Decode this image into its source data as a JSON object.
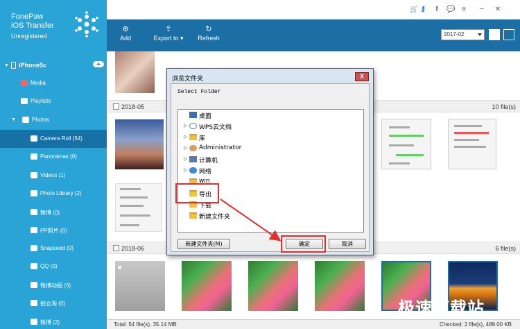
{
  "app": {
    "name_line1": "FonePaw",
    "name_line2": "iOS Transfer",
    "status": "Unregistered"
  },
  "device": {
    "name": "iPhone5c"
  },
  "sidebar": {
    "items": [
      {
        "label": "Media",
        "icon": "music-icon"
      },
      {
        "label": "Playlists",
        "icon": "playlist-icon"
      },
      {
        "label": "Photos",
        "icon": "photos-icon"
      },
      {
        "label": "Camera Roll (54)",
        "icon": "camera-icon"
      },
      {
        "label": "Panoramas (0)",
        "icon": "camera-icon"
      },
      {
        "label": "Videos (1)",
        "icon": "camera-icon"
      },
      {
        "label": "Photo Library (2)",
        "icon": "camera-icon"
      },
      {
        "label": "微博 (0)",
        "icon": "camera-icon"
      },
      {
        "label": "PP照片 (0)",
        "icon": "camera-icon"
      },
      {
        "label": "Snapseed (0)",
        "icon": "camera-icon"
      },
      {
        "label": "QQ (0)",
        "icon": "camera-icon"
      },
      {
        "label": "微博动图 (0)",
        "icon": "camera-icon"
      },
      {
        "label": "拍立淘 (0)",
        "icon": "camera-icon"
      },
      {
        "label": "微博 (2)",
        "icon": "camera-icon"
      }
    ]
  },
  "toolbar": {
    "add": "Add",
    "export": "Export to",
    "refresh": "Refresh",
    "date": "2017-02"
  },
  "sections": [
    {
      "date": "2018-05",
      "count": "10 file(s)"
    },
    {
      "date": "2018-06",
      "count": "6 file(s)"
    }
  ],
  "status": {
    "left": "Total: 54 file(s), 35.14 MB",
    "right": "Checked: 2 file(s), 489.00 KB"
  },
  "dialog": {
    "title": "浏览文件夹",
    "close": "X",
    "prompt": "Select Folder",
    "tree": [
      "桌面",
      "WPS云文档",
      "库",
      "Administrator",
      "计算机",
      "网络",
      "win",
      "导出",
      "下载",
      "新建文件夹"
    ],
    "new_folder": "新建文件夹(M)",
    "ok": "确定",
    "cancel": "取消"
  },
  "watermark": "极速下载站",
  "colors": {
    "sidebar": "#2aa3d7",
    "toolbar": "#1c6fa5",
    "active": "#1571a6",
    "highlight": "#e03030"
  }
}
